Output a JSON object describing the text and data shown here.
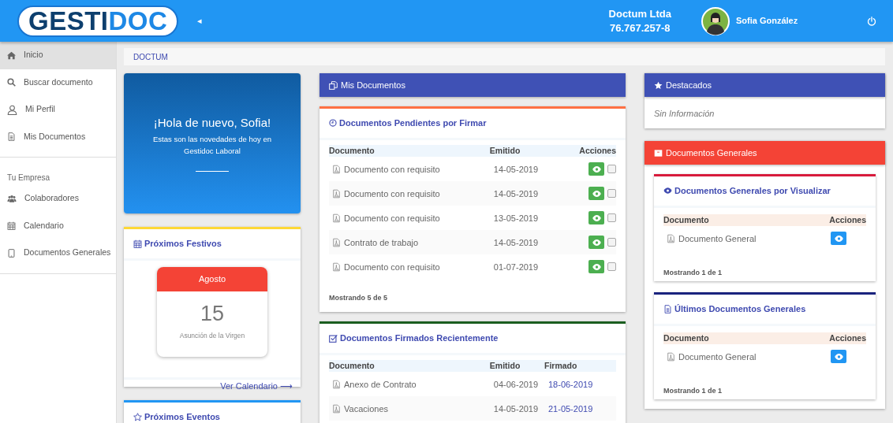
{
  "header": {
    "logo": {
      "part_1": "GESTI",
      "part_2": "DOC"
    },
    "toggle": "◂",
    "company": "Doctum Ltda",
    "company_id": "76.767.257-8",
    "user": "Sofia González"
  },
  "sidebar": {
    "items": [
      {
        "label": "Inicio",
        "selected": true
      },
      {
        "label": "Buscar documento",
        "selected": false
      },
      {
        "label": "Mi Perfil",
        "selected": false
      },
      {
        "label": "Mis Documentos",
        "selected": false
      }
    ],
    "section": {
      "title": "Tu Empresa",
      "items": [
        {
          "label": "Colaboradores",
          "selected": false
        },
        {
          "label": "Calendario",
          "selected": false
        },
        {
          "label": "Documentos Generales",
          "selected": false
        }
      ]
    }
  },
  "breadcrumb": "DOCTUM",
  "welcome": {
    "title": "¡Hola de nuevo, Sofia!",
    "text": "Estas son las novedades de hoy en Gestidoc Laboral"
  },
  "holidays": {
    "title": "Próximos Festivos",
    "month": "Agosto",
    "day": "15",
    "name": "Asunción de la Virgen",
    "link": "Ver Calendario ⟶"
  },
  "events": {
    "title": "Próximos Eventos"
  },
  "my_documents": {
    "title": "Mis Documentos",
    "pending": {
      "title": "Documentos Pendientes por Firmar",
      "columns": [
        "Documento",
        "Emitido",
        "Acciones"
      ],
      "rows": [
        {
          "document": "Documento con requisito",
          "issued": "14-05-2019",
          "checked": false
        },
        {
          "document": "Documento con requisito",
          "issued": "14-05-2019",
          "checked": false
        },
        {
          "document": "Documento con requisito",
          "issued": "13-05-2019",
          "checked": false
        },
        {
          "document": "Contrato de trabajo",
          "issued": "14-05-2019",
          "checked": false
        },
        {
          "document": "Documento con requisito",
          "issued": "01-07-2019",
          "checked": false
        }
      ],
      "footer": "Mostrando 5 de 5"
    },
    "signed": {
      "title": "Documentos Firmados Recientemente",
      "columns": [
        "Documento",
        "Emitido",
        "Firmado"
      ],
      "rows": [
        {
          "document": "Anexo de Contrato",
          "issued": "04-06-2019",
          "signed": "18-06-2019"
        },
        {
          "document": "Vacaciones",
          "issued": "14-05-2019",
          "signed": "21-05-2019"
        }
      ]
    }
  },
  "featured": {
    "title": "Destacados",
    "empty": "Sin Información"
  },
  "general": {
    "title": "Documentos Generales",
    "sections": [
      {
        "title": "Documentos Generales por Visualizar",
        "color": "#d81b3c",
        "columns": [
          "Documento",
          "Acciones"
        ],
        "rows": [
          {
            "document": "Documento General"
          }
        ],
        "footer": "Mostrando 1 de 1"
      },
      {
        "title": "Últimos Documentos Generales",
        "color": "#1a237e",
        "columns": [
          "Documento",
          "Acciones"
        ],
        "rows": [
          {
            "document": "Documento General"
          }
        ],
        "footer": "Mostrando 1 de 1"
      }
    ]
  }
}
